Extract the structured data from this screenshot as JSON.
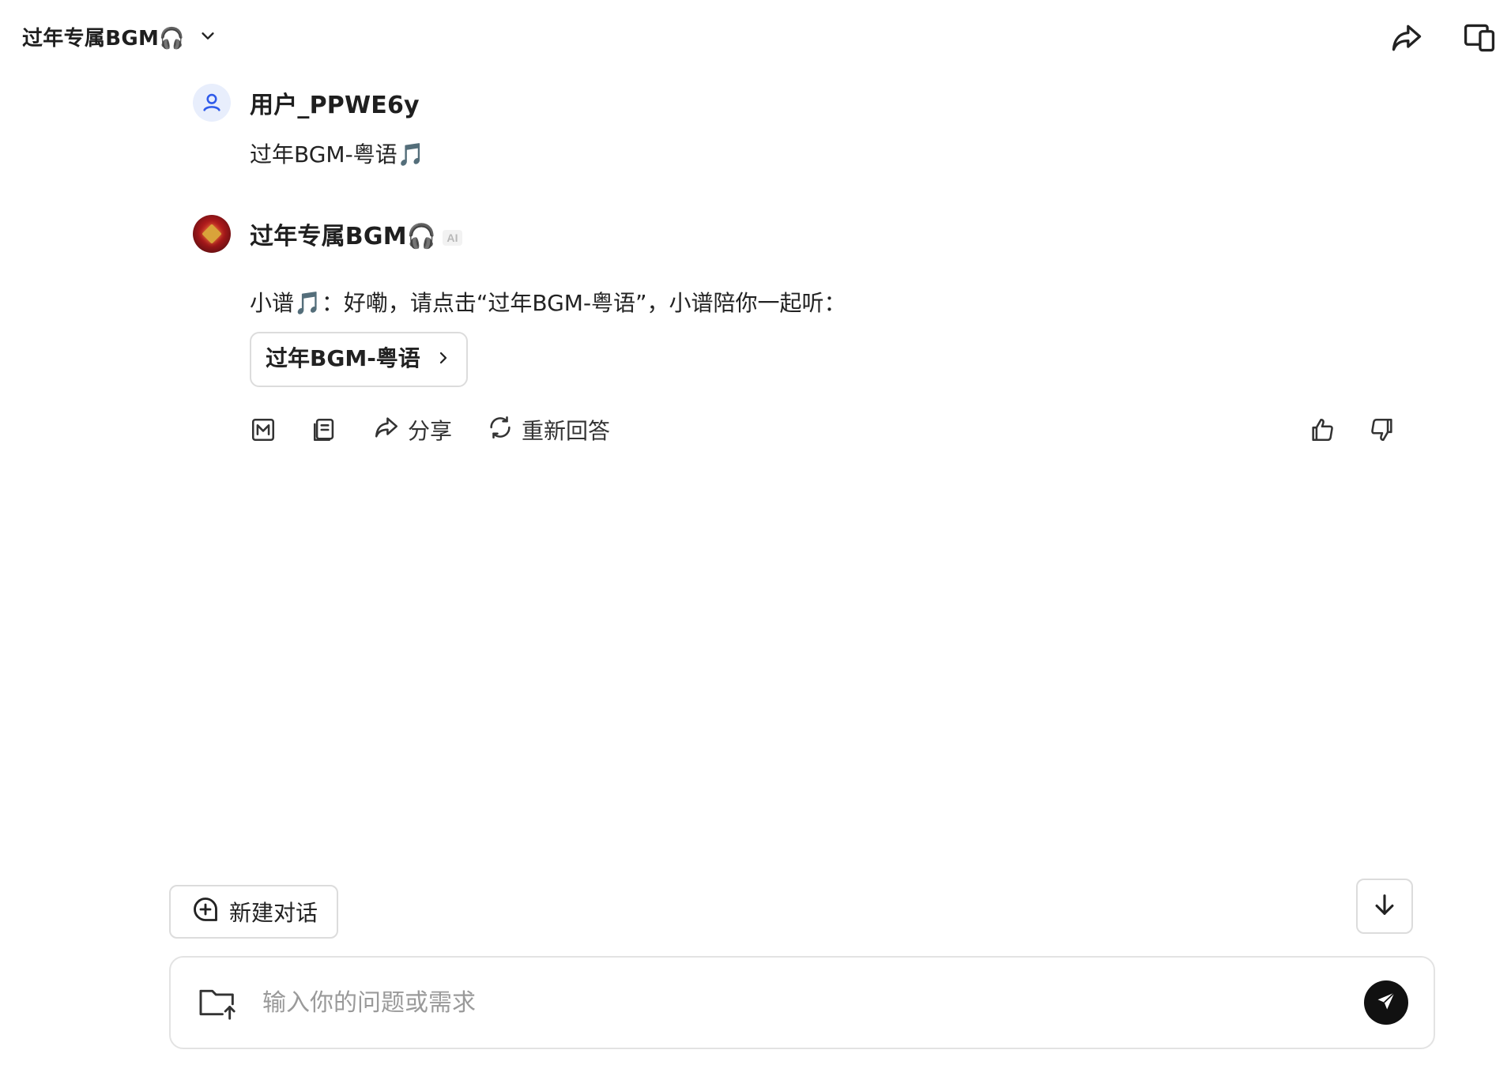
{
  "header": {
    "bot_title": "过年专属BGM🎧",
    "actions": [
      "share-icon",
      "multi-device-icon"
    ]
  },
  "conversation": {
    "user_message": {
      "username": "用户_PPWE6y",
      "text": "过年BGM-粤语🎵"
    },
    "bot_message": {
      "name": "过年专属BGM🎧",
      "ai_badge": "AI",
      "text": "小谱🎵：好嘞，请点击“过年BGM-粤语”，小谱陪你一起听：",
      "link_card_label": "过年BGM-粤语",
      "actions": {
        "share_label": "分享",
        "regenerate_label": "重新回答"
      }
    }
  },
  "footer": {
    "new_chat_label": "新建对话",
    "input_placeholder": "输入你的问题或需求",
    "input_value": ""
  }
}
